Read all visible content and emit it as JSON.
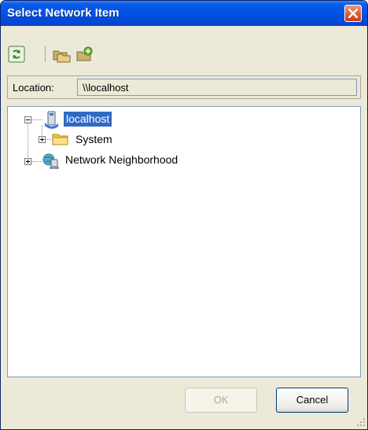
{
  "window": {
    "title": "Select Network Item"
  },
  "toolbar": {
    "buttons": [
      {
        "name": "refresh",
        "icon": "refresh-icon"
      },
      {
        "name": "map-drive",
        "icon": "map-network-drive-icon"
      },
      {
        "name": "connect",
        "icon": "connect-drive-icon"
      }
    ]
  },
  "location": {
    "label": "Location:",
    "value": "\\\\localhost"
  },
  "tree": {
    "nodes": [
      {
        "label": "localhost",
        "icon": "computer-icon",
        "expanded": true,
        "selected": true
      },
      {
        "label": "System",
        "icon": "folder-icon",
        "expanded": false,
        "selected": false
      },
      {
        "label": "Network Neighborhood",
        "icon": "network-icon",
        "expanded": false,
        "selected": false
      }
    ]
  },
  "buttons": {
    "ok_label": "OK",
    "cancel_label": "Cancel",
    "ok_enabled": false
  },
  "colors": {
    "title_bar": "#0055e6",
    "selection": "#316ac5",
    "dialog_bg": "#ece9d8"
  }
}
